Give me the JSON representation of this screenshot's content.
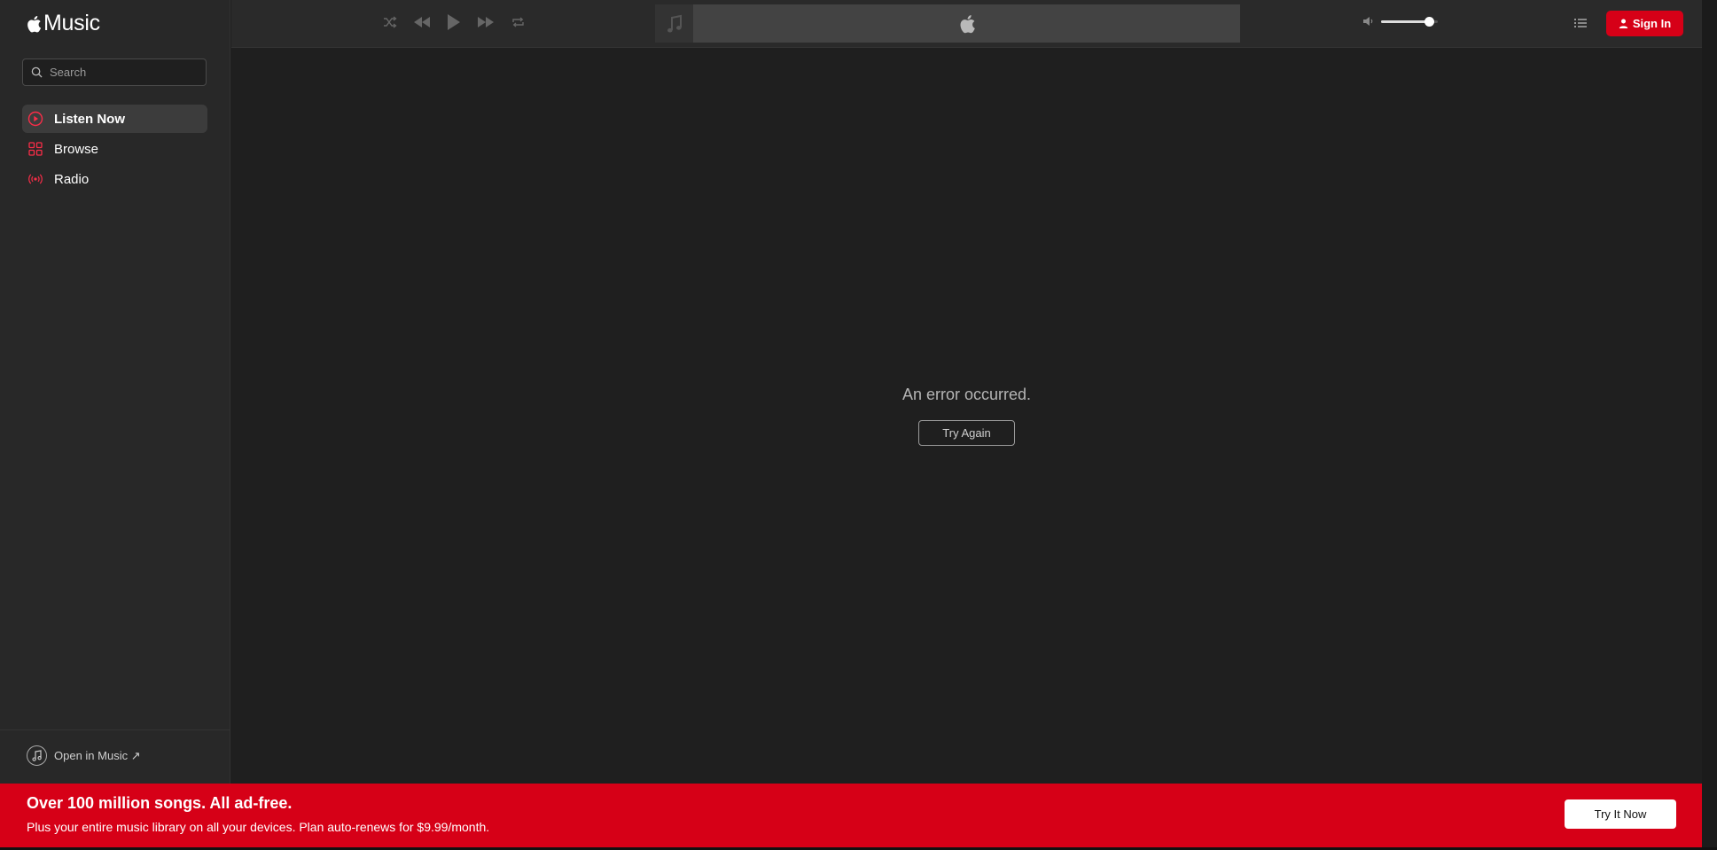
{
  "app": {
    "brand": "Music"
  },
  "sidebar": {
    "search_placeholder": "Search",
    "items": [
      {
        "label": "Listen Now",
        "icon": "play-circle-icon",
        "active": true
      },
      {
        "label": "Browse",
        "icon": "grid-icon",
        "active": false
      },
      {
        "label": "Radio",
        "icon": "radio-waves-icon",
        "active": false
      }
    ],
    "open_in_music": "Open in Music ↗"
  },
  "topbar": {
    "sign_in_label": "Sign In",
    "volume_level": 0.85
  },
  "main": {
    "error_message": "An error occurred.",
    "try_again_label": "Try Again"
  },
  "banner": {
    "title": "Over 100 million songs. All ad-free.",
    "subtitle": "Plus your entire music library on all your devices. Plan auto-renews for $9.99/month.",
    "cta_label": "Try It Now"
  },
  "colors": {
    "accent": "#d60017",
    "sidebar_bg": "#282828",
    "main_bg": "#1f1f1f",
    "icon_accent": "#fa2d48"
  }
}
